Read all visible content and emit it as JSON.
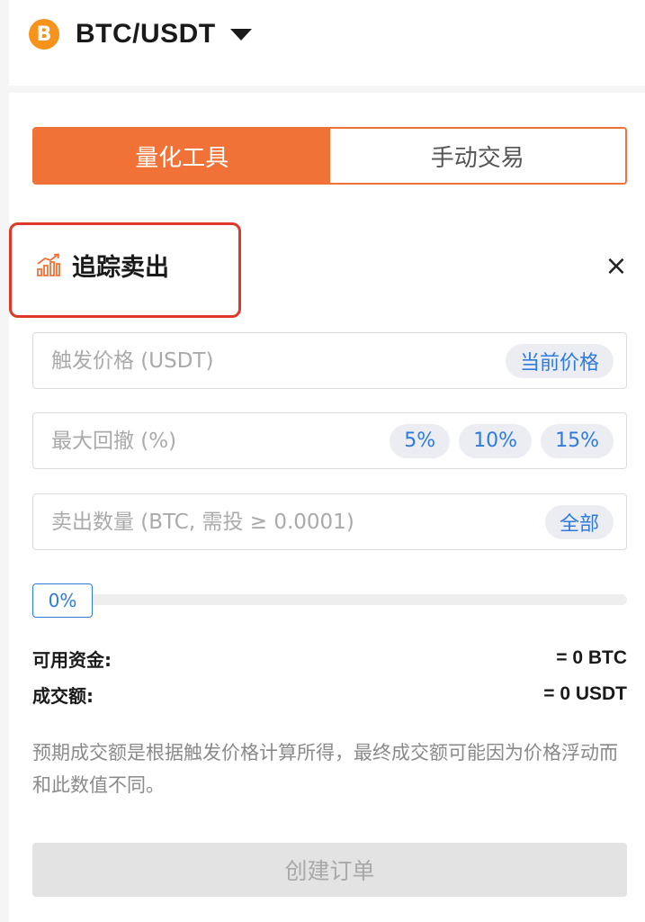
{
  "header": {
    "coin_symbol": "B",
    "pair": "BTC/USDT"
  },
  "tabs": [
    {
      "label": "量化工具",
      "active": true
    },
    {
      "label": "手动交易",
      "active": false
    }
  ],
  "section": {
    "title": "追踪卖出",
    "close": "×"
  },
  "fields": {
    "trigger_price": {
      "placeholder": "触发价格 (USDT)",
      "value": "",
      "button": "当前价格"
    },
    "max_drawdown": {
      "placeholder": "最大回撤 (%)",
      "value": "",
      "options": [
        "5%",
        "10%",
        "15%"
      ]
    },
    "sell_amount": {
      "placeholder": "卖出数量 (BTC, 需投 ≥ 0.0001)",
      "value": "",
      "button": "全部"
    }
  },
  "slider": {
    "label": "0%",
    "percent": 0
  },
  "info": {
    "available_label": "可用资金:",
    "available_value": "= 0 BTC",
    "turnover_label": "成交额:",
    "turnover_value": "= 0 USDT"
  },
  "notice": "预期成交额是根据触发价格计算所得，最终成交额可能因为价格浮动而和此数值不同。",
  "submit_label": "创建订单",
  "colors": {
    "accent": "#f07236",
    "link": "#2f7bdc",
    "coin": "#f7931a",
    "highlight": "#e0372b"
  }
}
